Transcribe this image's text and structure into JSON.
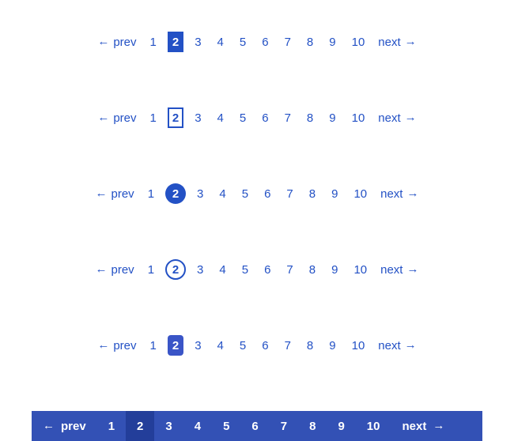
{
  "prev_label": "prev",
  "next_label": "next",
  "arrow_left": "←",
  "arrow_right": "→",
  "pages": [
    "1",
    "2",
    "3",
    "4",
    "5",
    "6",
    "7",
    "8",
    "9",
    "10"
  ],
  "variants": [
    {
      "style": "v1",
      "active": "2"
    },
    {
      "style": "v2",
      "active": "2"
    },
    {
      "style": "v3",
      "active": "2"
    },
    {
      "style": "v4",
      "active": "2"
    },
    {
      "style": "v5",
      "active": "2"
    },
    {
      "style": "v6",
      "active": "2"
    }
  ],
  "colors": {
    "link": "#2351c5",
    "bar_bg": "#3351b5",
    "bar_active": "#233e9a"
  }
}
